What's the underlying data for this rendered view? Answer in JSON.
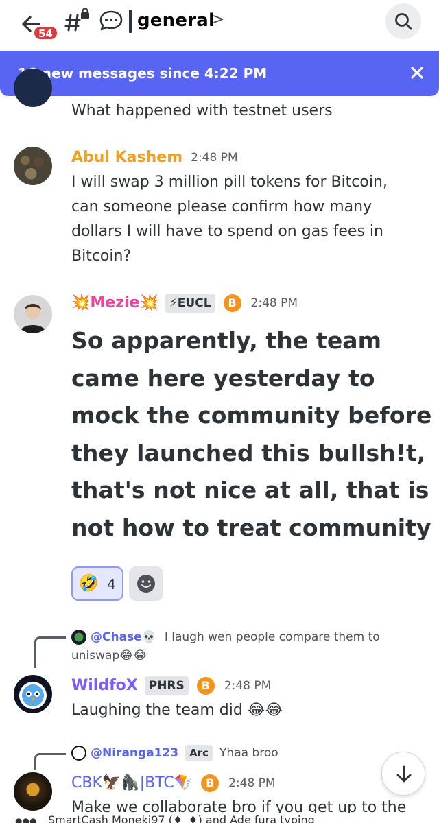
{
  "header": {
    "unread_count": "54",
    "channel_name": "general",
    "icons": [
      "back-arrow-icon",
      "channel-hash-lock-icon",
      "thread-icon",
      "chevron-right-icon",
      "search-icon"
    ]
  },
  "banner": {
    "text": "16 new messages since 4:22 PM",
    "color": "#5865f2"
  },
  "messages": [
    {
      "text": "What happened with testnet users"
    },
    {
      "username": "Abul Kashem",
      "username_color": "#f0a020",
      "time": "2:48 PM",
      "text_lines": [
        "I will swap 3 million pill tokens for Bitcoin,",
        "can someone please confirm how many",
        "dollars I will have to spend on gas fees in",
        "Bitcoin?"
      ]
    },
    {
      "username": "💥Mezie💥",
      "username_color": "#eb459e",
      "tag": "⚡EUCL",
      "badge": "B",
      "time": "2:48 PM",
      "text": "So apparently, the team came here yesterday to mock the community before they launched this bullsh!t, that's not nice at all, that is not how to treat community",
      "reactions": [
        {
          "emoji": "🤣",
          "count": "4"
        },
        {
          "emoji": "add-reaction-icon"
        }
      ]
    },
    {
      "reply": {
        "username": "@Chase💀",
        "text_line1": "I laugh wen people compare them to",
        "text_line2": "uniswap😂😂"
      },
      "username": "WildfoX",
      "username_color": "#7c5cff",
      "tag": "PHRS",
      "badge": "B",
      "time": "2:48 PM",
      "text": "Laughing the team did 😂😂"
    },
    {
      "reply": {
        "username": "@Niranga123",
        "tag": "Arc",
        "text_line1": "Yhaa broo"
      },
      "username": "CBK🦅🦍|BTC🪁",
      "username_color": "#5865f2",
      "badge": "B",
      "time": "2:48 PM",
      "text": "Make we collaborate bro if you get up to the"
    }
  ],
  "typing": "SmartCash Moneki97 (♦_♦) and Ade fura typing"
}
